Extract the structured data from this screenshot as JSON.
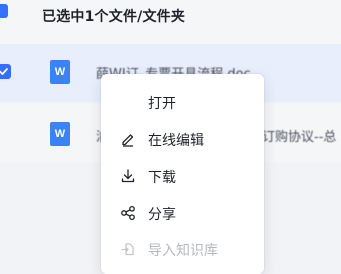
{
  "header": {
    "title": "已选中1个文件/文件夹"
  },
  "files": [
    {
      "icon_letter": "W",
      "name": "薛WI订_专票开具流程.doc",
      "name_right": ""
    },
    {
      "icon_letter": "W",
      "name": "渝",
      "name_right": "订购协议--总"
    }
  ],
  "menu": {
    "items": [
      {
        "label": "打开",
        "icon": ""
      },
      {
        "label": "在线编辑",
        "icon": "pencil-icon"
      },
      {
        "label": "下载",
        "icon": "download-icon"
      },
      {
        "label": "分享",
        "icon": "share-icon"
      },
      {
        "label": "导入知识库",
        "icon": "import-icon",
        "disabled": true
      }
    ]
  },
  "colors": {
    "accent": "#3370ff",
    "doc_icon": "#3b82f6",
    "selected_row": "#e8eefc",
    "menu_bg": "#ffffff",
    "disabled_text": "#b6b9bf"
  }
}
